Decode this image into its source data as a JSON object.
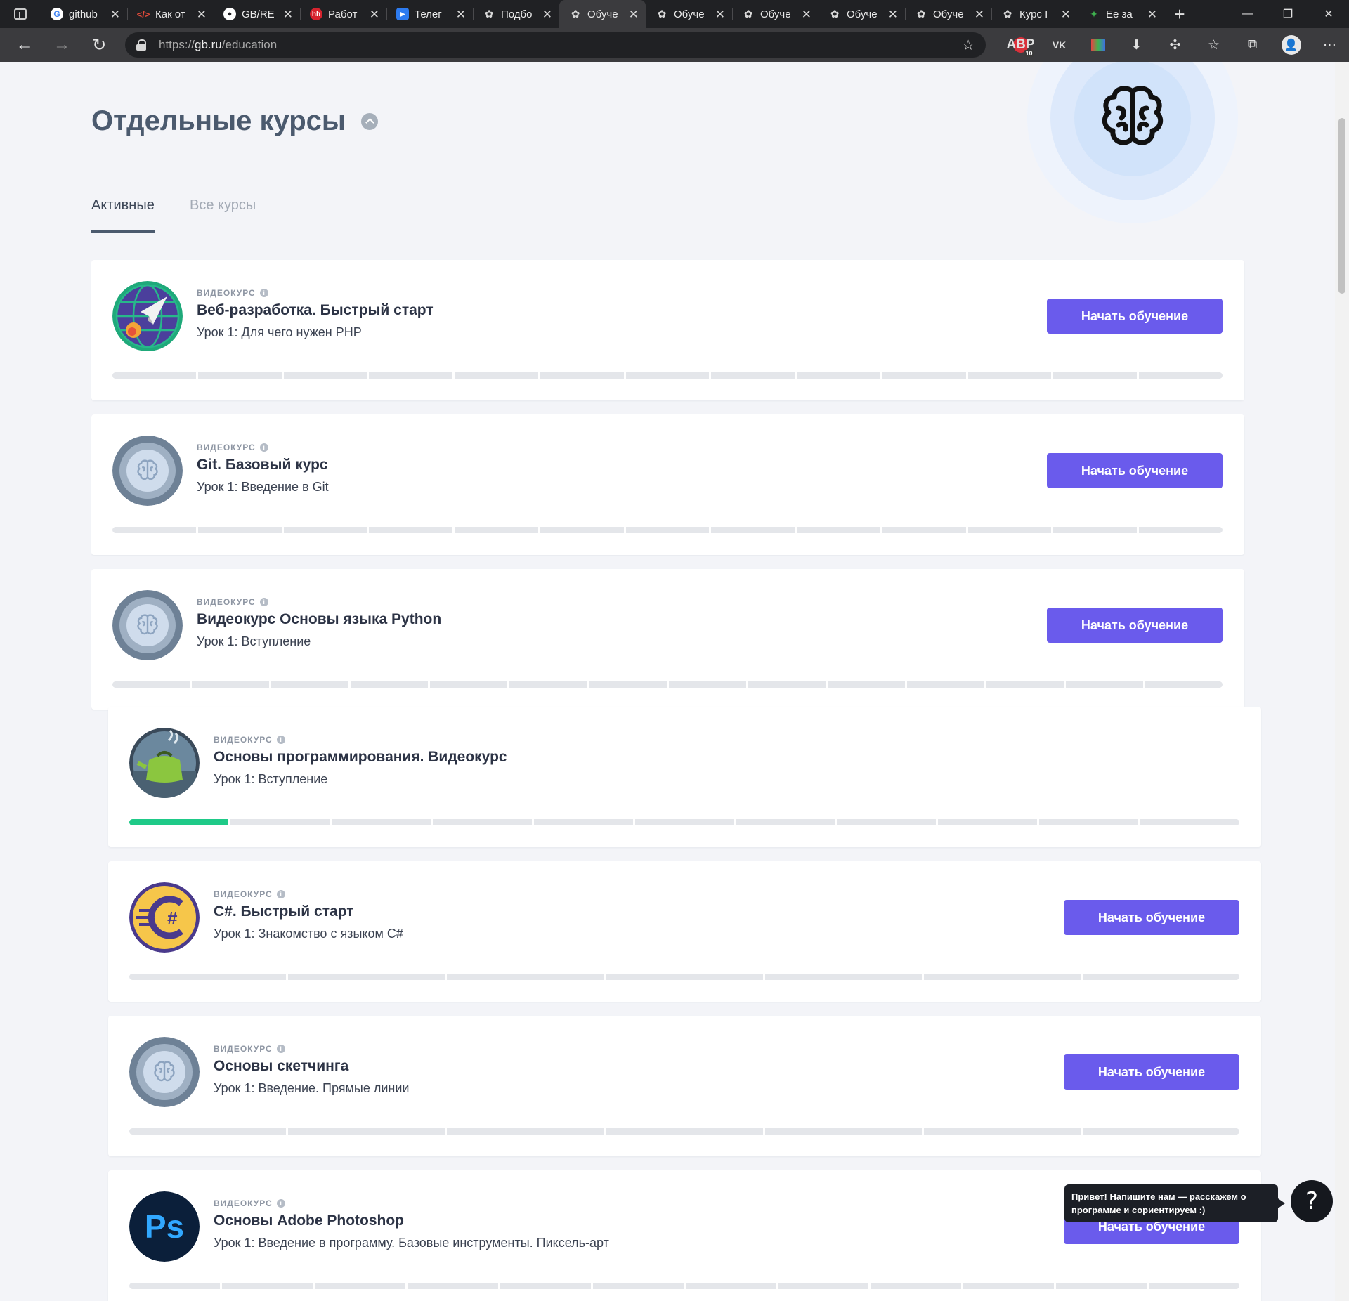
{
  "browser": {
    "tabs": [
      {
        "title": "github",
        "icon": "google-icon",
        "active": false
      },
      {
        "title": "Как от",
        "icon": "code-icon",
        "active": false
      },
      {
        "title": "GB/RE",
        "icon": "github-icon",
        "active": false
      },
      {
        "title": "Работ",
        "icon": "hh-icon",
        "active": false
      },
      {
        "title": "Телег",
        "icon": "play-icon",
        "active": false
      },
      {
        "title": "Подбо",
        "icon": "gb-brain-icon",
        "active": false
      },
      {
        "title": "Обуче",
        "icon": "gb-brain-icon",
        "active": true
      },
      {
        "title": "Обуче",
        "icon": "gb-brain-icon",
        "active": false
      },
      {
        "title": "Обуче",
        "icon": "gb-brain-icon",
        "active": false
      },
      {
        "title": "Обуче",
        "icon": "gb-brain-icon",
        "active": false
      },
      {
        "title": "Обуче",
        "icon": "gb-brain-icon",
        "active": false
      },
      {
        "title": "Курс I",
        "icon": "gb-brain-icon",
        "active": false
      },
      {
        "title": "Ее за",
        "icon": "game-icon",
        "active": false
      }
    ],
    "url_prefix": "https://",
    "url_host": "gb.ru",
    "url_path": "/education",
    "ext_badge": "10",
    "ext_abp": "ABP",
    "ext_vk": "VK"
  },
  "page": {
    "section_title": "Отдельные курсы",
    "tabs": [
      "Активные",
      "Все курсы"
    ],
    "kind_label": "ВИДЕОКУРС",
    "start_label": "Начать обучение",
    "courses": [
      {
        "title": "Веб-разработка. Быстрый старт",
        "lesson": "Урок 1: Для чего нужен PHP",
        "logo": "rocket-logo",
        "segments": 13,
        "done": 0,
        "button": true
      },
      {
        "title": "Git. Базовый курс",
        "lesson": "Урок 1: Введение в Git",
        "logo": "brain-logo",
        "segments": 13,
        "done": 0,
        "button": true
      },
      {
        "title": "Видеокурс Основы языка Python",
        "lesson": "Урок 1: Вступление",
        "logo": "brain-logo",
        "segments": 14,
        "done": 0,
        "button": true
      },
      {
        "title": "Основы программирования. Видеокурс",
        "lesson": "Урок 1: Вступление",
        "logo": "kettle-logo",
        "segments": 11,
        "done": 1,
        "button": false
      },
      {
        "title": "C#. Быстрый старт",
        "lesson": "Урок 1: Знакомство с языком C#",
        "logo": "csharp-logo",
        "segments": 7,
        "done": 0,
        "button": true
      },
      {
        "title": "Основы скетчинга",
        "lesson": "Урок 1: Введение. Прямые линии",
        "logo": "brain-logo",
        "segments": 7,
        "done": 0,
        "button": true
      },
      {
        "title": "Основы Adobe Photoshop",
        "lesson": "Урок 1: Введение в программу. Базовые инструменты. Пиксель-арт",
        "logo": "photoshop-logo",
        "segments": 12,
        "done": 0,
        "button": true
      }
    ]
  },
  "chat": {
    "tip": "Привет! Напишите нам — расскажем о программе и сориентируем :)",
    "button_label": "?"
  }
}
